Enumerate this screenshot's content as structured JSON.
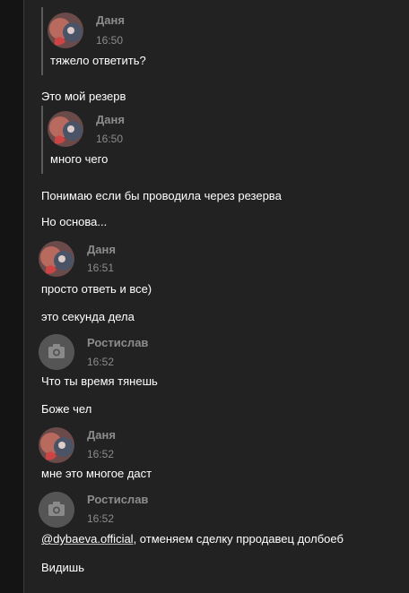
{
  "colors": {
    "page_bg": "#141414",
    "panel_bg": "#222222",
    "name": "#8c8c8c",
    "time": "#8c8c8c",
    "text": "#ffffff"
  },
  "messages": [
    {
      "type": "quoted",
      "author": "Даня",
      "time": "16:50",
      "text": "тяжело ответить?",
      "avatar": "anime-avatar"
    },
    {
      "type": "plain",
      "text": "Это мой резерв"
    },
    {
      "type": "quoted",
      "author": "Даня",
      "time": "16:50",
      "text": "много чего",
      "avatar": "anime-avatar"
    },
    {
      "type": "plain",
      "text": "Понимаю если бы проводила через резерва"
    },
    {
      "type": "plain",
      "text": "Но основа..."
    },
    {
      "type": "message",
      "author": "Даня",
      "time": "16:51",
      "text": "просто ответь и все)",
      "avatar": "anime-avatar"
    },
    {
      "type": "plain",
      "text": "это секунда дела"
    },
    {
      "type": "message",
      "author": "Ростислав",
      "time": "16:52",
      "text": "Что ты время тянешь",
      "avatar": "camera-icon"
    },
    {
      "type": "plain",
      "text": "Боже чел"
    },
    {
      "type": "message",
      "author": "Даня",
      "time": "16:52",
      "text": "мне это многое даст",
      "avatar": "anime-avatar"
    },
    {
      "type": "message",
      "author": "Ростислав",
      "time": "16:52",
      "mention": "@dybaeva.official",
      "text": ", отменяем сделку прродавец долбоеб",
      "avatar": "camera-icon"
    },
    {
      "type": "plain",
      "text": "Видишь"
    }
  ]
}
